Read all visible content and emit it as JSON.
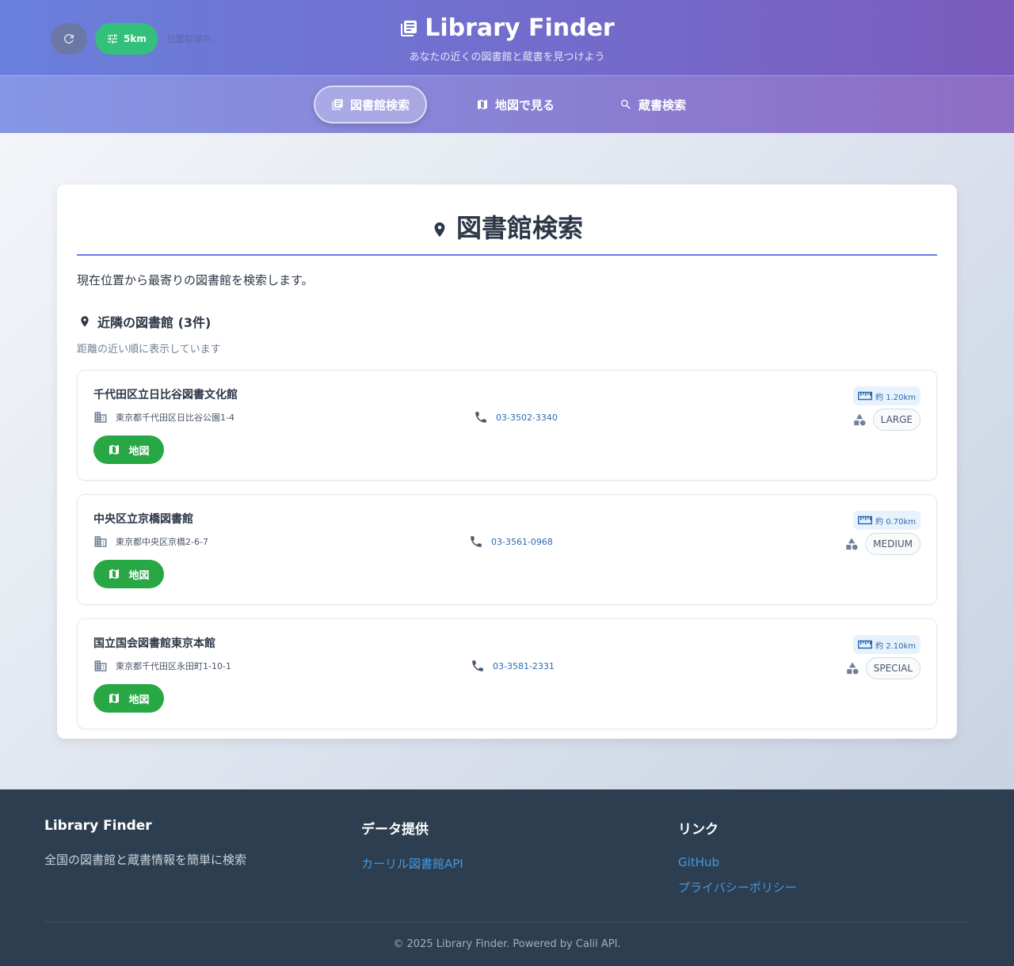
{
  "header": {
    "title": "Library Finder",
    "subtitle": "あなたの近くの図書館と蔵書を見つけよう",
    "radius_label": "5km",
    "location_status": "位置取得中..."
  },
  "nav": {
    "tabs": [
      {
        "label": "図書館検索",
        "icon": "library-icon",
        "active": true
      },
      {
        "label": "地図で見る",
        "icon": "map-icon",
        "active": false
      },
      {
        "label": "蔵書検索",
        "icon": "search-icon",
        "active": false
      }
    ]
  },
  "main": {
    "title": "図書館検索",
    "description": "現在位置から最寄りの図書館を検索します。",
    "section_title": "近隣の図書館 (3件)",
    "section_subtitle": "距離の近い順に表示しています",
    "map_button_label": "地図",
    "libraries": [
      {
        "name": "千代田区立日比谷図書文化館",
        "address": "東京都千代田区日比谷公園1-4",
        "tel": "03-3502-3340",
        "distance": "約 1.20km",
        "category": "LARGE"
      },
      {
        "name": "中央区立京橋図書館",
        "address": "東京都中央区京橋2-6-7",
        "tel": "03-3561-0968",
        "distance": "約 0.70km",
        "category": "MEDIUM"
      },
      {
        "name": "国立国会図書館東京本館",
        "address": "東京都千代田区永田町1-10-1",
        "tel": "03-3581-2331",
        "distance": "約 2.10km",
        "category": "SPECIAL"
      }
    ]
  },
  "footer": {
    "col1": {
      "title": "Library Finder",
      "text": "全国の図書館と蔵書情報を簡単に検索"
    },
    "col2": {
      "title": "データ提供",
      "links": [
        "カーリル図書館API"
      ]
    },
    "col3": {
      "title": "リンク",
      "links": [
        "GitHub",
        "プライバシーポリシー"
      ]
    },
    "copyright": "© 2025 Library Finder. Powered by Calil API."
  },
  "colors": {
    "accent": "#667eea",
    "header_start": "#6a7fdc",
    "header_end": "#7a5cbe",
    "success": "#28a745",
    "link": "#4299e1",
    "footer_bg": "#2d3e50"
  }
}
